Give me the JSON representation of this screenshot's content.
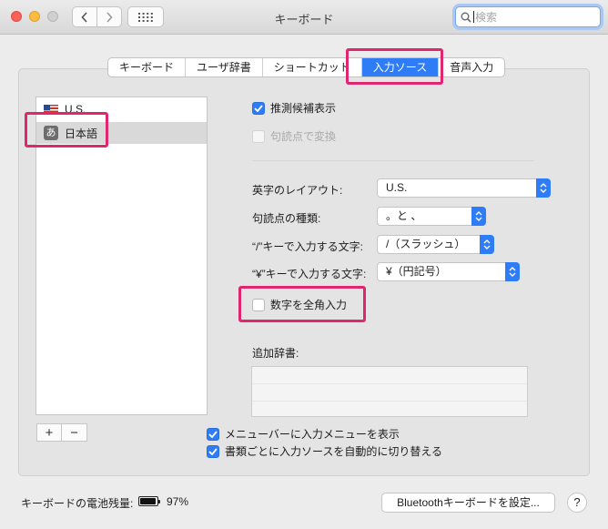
{
  "window": {
    "title": "キーボード"
  },
  "search": {
    "placeholder": "検索"
  },
  "tabs": [
    {
      "label": "キーボード"
    },
    {
      "label": "ユーザ辞書"
    },
    {
      "label": "ショートカット"
    },
    {
      "label": "入力ソース",
      "active": true
    },
    {
      "label": "音声入力"
    }
  ],
  "sources": [
    {
      "label": "U.S.",
      "icon": "us-flag-icon"
    },
    {
      "label": "日本語",
      "icon_text": "あ",
      "selected": true
    }
  ],
  "options": {
    "predictive": {
      "label": "推測候補表示",
      "checked": true
    },
    "punct_convert": {
      "label": "句読点で変換",
      "checked": false,
      "disabled": true
    },
    "layout_label": "英字のレイアウト:",
    "layout_value": "U.S.",
    "punct_type_label": "句読点の種類:",
    "punct_type_value": "。と 、",
    "slash_label": "“/”キーで入力する文字:",
    "slash_value": "/（スラッシュ）",
    "yen_label": "“¥”キーで入力する文字:",
    "yen_value": "¥（円記号）",
    "fullwidth_numbers": {
      "label": "数字を全角入力",
      "checked": false
    },
    "dictionary_label": "追加辞書:"
  },
  "list_controls": {
    "add": "+",
    "remove": "−"
  },
  "global_options": {
    "show_menu": {
      "label": "メニューバーに入力メニューを表示",
      "checked": true
    },
    "auto_switch": {
      "label": "書類ごとに入力ソースを自動的に切り替える",
      "checked": true
    }
  },
  "footer": {
    "battery_label": "キーボードの電池残量:",
    "battery_percent": "97%",
    "battery_level": 0.97,
    "bluetooth_button": "Bluetoothキーボードを設定...",
    "help_button": "?"
  },
  "colors": {
    "accent": "#2e7cf6",
    "highlight": "#e0266e"
  }
}
